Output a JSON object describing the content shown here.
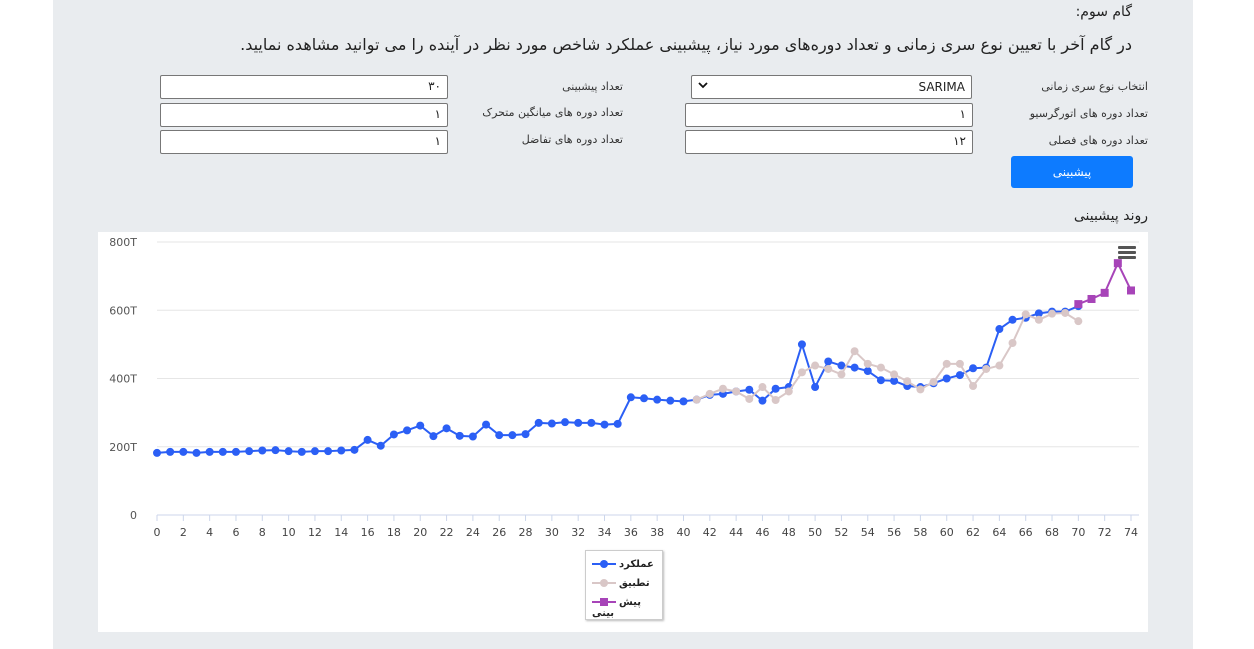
{
  "header": {
    "step_title": "گام سوم:",
    "description": "در گام آخر با تعیین نوع سری زمانی و تعداد دوره‌های مورد نیاز، پیشبینی عملکرد شاخص مورد نظر در آینده را می توانید مشاهده نمایید."
  },
  "form": {
    "series_type_label": "انتخاب نوع سری زمانی",
    "series_type_value": "SARIMA",
    "forecast_count_label": "تعداد پیشبینی",
    "forecast_count_value": "۳۰",
    "ar_periods_label": "تعداد دوره های اتورگرسیو",
    "ar_periods_value": "۱",
    "ma_periods_label": "تعداد دوره های میانگین متحرک",
    "ma_periods_value": "۱",
    "seasonal_periods_label": "تعداد دوره های فصلی",
    "seasonal_periods_value": "۱۲",
    "diff_periods_label": "تعداد دوره های تفاضل",
    "diff_periods_value": "۱",
    "predict_button": "پیشبینی"
  },
  "trend_title": "روند پیشبینی",
  "chart_data": {
    "type": "line",
    "xlim": [
      0,
      74
    ],
    "ylim": [
      0,
      800
    ],
    "x_ticks": [
      0,
      2,
      4,
      6,
      8,
      10,
      12,
      14,
      16,
      18,
      20,
      22,
      24,
      26,
      28,
      30,
      32,
      34,
      36,
      38,
      40,
      42,
      44,
      46,
      48,
      50,
      52,
      54,
      56,
      58,
      60,
      62,
      64,
      66,
      68,
      70,
      72,
      74
    ],
    "y_ticks": [
      0,
      200,
      400,
      600,
      800
    ],
    "y_tick_labels": [
      "0",
      "200T",
      "400T",
      "600T",
      "800T"
    ],
    "grid": true,
    "legend_position": "bottom-center",
    "series": [
      {
        "name": "عملکرد",
        "color": "#2b5ff5",
        "marker": "circle",
        "x": [
          0,
          1,
          2,
          3,
          4,
          5,
          6,
          7,
          8,
          9,
          10,
          11,
          12,
          13,
          14,
          15,
          16,
          17,
          18,
          19,
          20,
          21,
          22,
          23,
          24,
          25,
          26,
          27,
          28,
          29,
          30,
          31,
          32,
          33,
          34,
          35,
          36,
          37,
          38,
          39,
          40,
          41,
          42,
          43,
          44,
          45,
          46,
          47,
          48,
          49,
          50,
          51,
          52,
          53,
          54,
          55,
          56,
          57,
          58,
          59,
          60,
          61,
          62,
          63,
          64,
          65,
          66,
          67,
          68,
          69,
          70
        ],
        "values": [
          182,
          185,
          185,
          182,
          185,
          185,
          185,
          187,
          189,
          190,
          187,
          185,
          187,
          187,
          189,
          191,
          220,
          203,
          236,
          248,
          262,
          231,
          254,
          232,
          230,
          265,
          234,
          234,
          237,
          270,
          268,
          272,
          270,
          270,
          265,
          267,
          345,
          342,
          338,
          335,
          333,
          338,
          352,
          355,
          362,
          367,
          335,
          370,
          375,
          500,
          375,
          450,
          438,
          432,
          422,
          395,
          393,
          378,
          375,
          386,
          400,
          410,
          430,
          432,
          545,
          572,
          578,
          591,
          596,
          596,
          612
        ],
        "x_end": 70
      },
      {
        "name": "تطبیق",
        "color": "#d9c7c7",
        "marker": "circle",
        "x": [
          41,
          42,
          43,
          44,
          45,
          46,
          47,
          48,
          49,
          50,
          51,
          52,
          53,
          54,
          55,
          56,
          57,
          58,
          59,
          60,
          61,
          62,
          63,
          64,
          65,
          66,
          67,
          68,
          69,
          70
        ],
        "values": [
          338,
          355,
          370,
          362,
          340,
          375,
          337,
          362,
          418,
          438,
          428,
          412,
          480,
          443,
          432,
          412,
          392,
          368,
          390,
          443,
          443,
          378,
          428,
          438,
          504,
          588,
          572,
          590,
          592,
          568
        ]
      },
      {
        "name": "پیش بینی",
        "color": "#a744b8",
        "marker": "square",
        "x": [
          70,
          71,
          72,
          73,
          74
        ],
        "values": [
          618,
          633,
          651,
          738,
          658
        ]
      }
    ]
  },
  "icons": {
    "menu": "hamburger-menu-icon",
    "select_chevron": "chevron-down-icon"
  }
}
